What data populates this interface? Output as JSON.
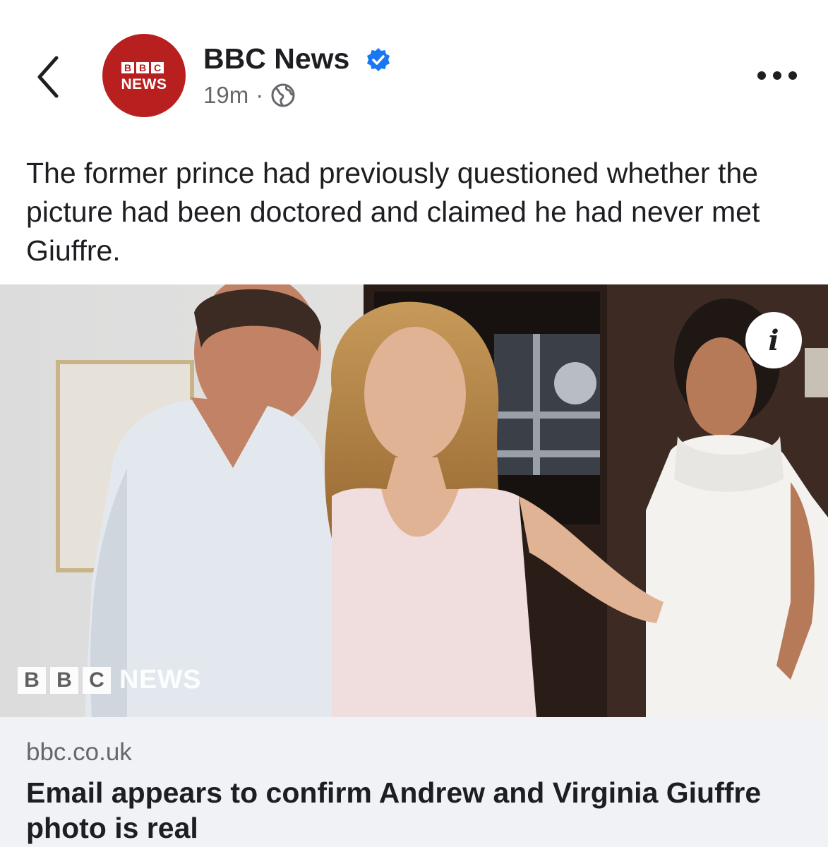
{
  "header": {
    "page_name": "BBC News",
    "timestamp": "19m",
    "separator": "·",
    "icons": {
      "back": "chevron-left-icon",
      "verified": "verified-badge-icon",
      "audience": "globe-icon",
      "more": "more-horizontal-icon"
    },
    "avatar": {
      "blocks": [
        "B",
        "B",
        "C"
      ],
      "label": "NEWS",
      "background": "#b8201f"
    }
  },
  "post": {
    "text": "The former prince had previously questioned whether the picture had been doctored and claimed he had never met Giuffre."
  },
  "photo": {
    "info_label": "i",
    "watermark": {
      "blocks": [
        "B",
        "B",
        "C"
      ],
      "label": "NEWS"
    }
  },
  "link": {
    "domain": "bbc.co.uk",
    "title": "Email appears to confirm Andrew and Virginia Giuffre photo is real"
  },
  "colors": {
    "verified": "#1877f2",
    "secondary_text": "#65676b",
    "link_card_bg": "#f0f2f5"
  }
}
